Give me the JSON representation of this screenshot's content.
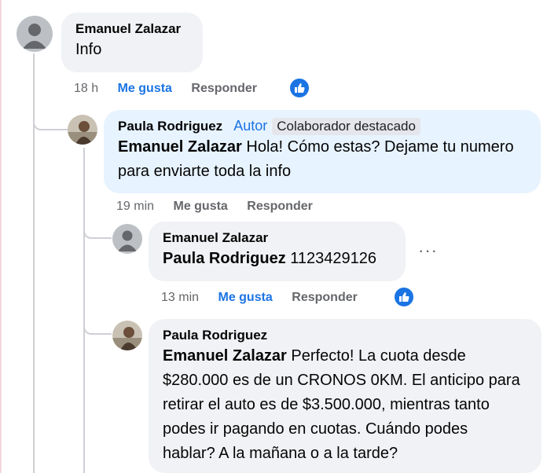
{
  "comments": [
    {
      "author": "Emanuel Zalazar",
      "text": "Info",
      "time": "18 h",
      "like_label": "Me gusta",
      "reply_label": "Responder",
      "liked": true
    },
    {
      "author": "Paula Rodriguez",
      "author_tag": "Autor",
      "badge": "Colaborador destacado",
      "mention": "Emanuel Zalazar",
      "text": "Hola! Cómo estas? Dejame tu numero para enviarte toda la info",
      "time": "19 min",
      "like_label": "Me gusta",
      "reply_label": "Responder",
      "liked": false
    },
    {
      "author": "Emanuel Zalazar",
      "mention": "Paula Rodriguez",
      "text": "1123429126",
      "time": "13 min",
      "like_label": "Me gusta",
      "reply_label": "Responder",
      "more": "···",
      "liked": true
    },
    {
      "author": "Paula Rodriguez",
      "mention": "Emanuel Zalazar",
      "text": "Perfecto! La cuota desde $280.000 es de un CRONOS 0KM. El anticipo para retirar el auto es de $3.500.000, mientras tanto podes ir pagando en cuotas. Cuándo podes hablar? A la mañana o a la tarde?"
    }
  ],
  "colors": {
    "accent": "#1b74e4",
    "bubble": "#f0f2f5",
    "bubble_highlight": "#e7f3ff",
    "muted": "#65676b"
  },
  "icons": {
    "reaction": "thumbs-up-icon",
    "avatar_default": "default-user-avatar",
    "avatar_photo": "profile-photo"
  }
}
